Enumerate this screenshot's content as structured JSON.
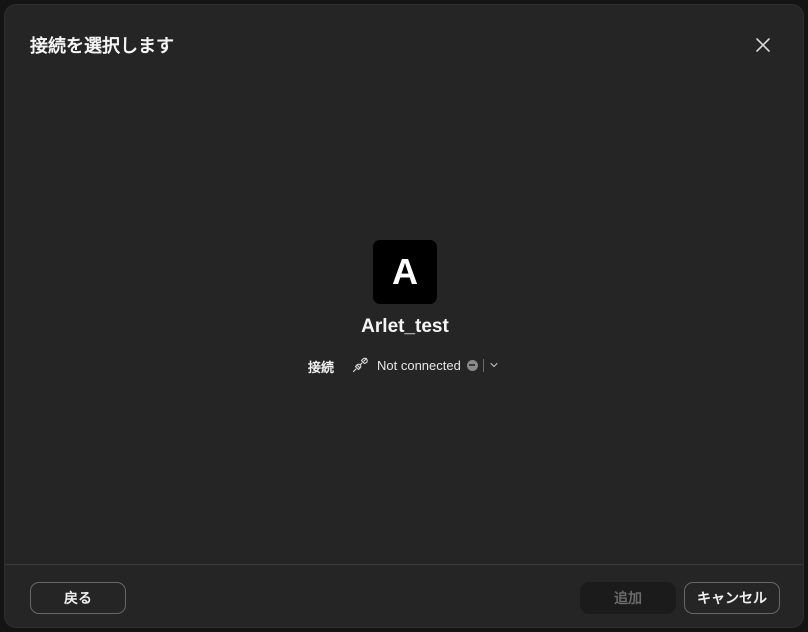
{
  "dialog": {
    "title": "接続を選択します",
    "close_icon": "close-icon"
  },
  "agent": {
    "initial": "A",
    "name": "Arlet_test"
  },
  "connection": {
    "label": "接続",
    "icon": "plug-icon",
    "status": "Not connected",
    "status_color": "#8a8a8a"
  },
  "footer": {
    "back_label": "戻る",
    "add_label": "追加",
    "cancel_label": "キャンセル"
  }
}
